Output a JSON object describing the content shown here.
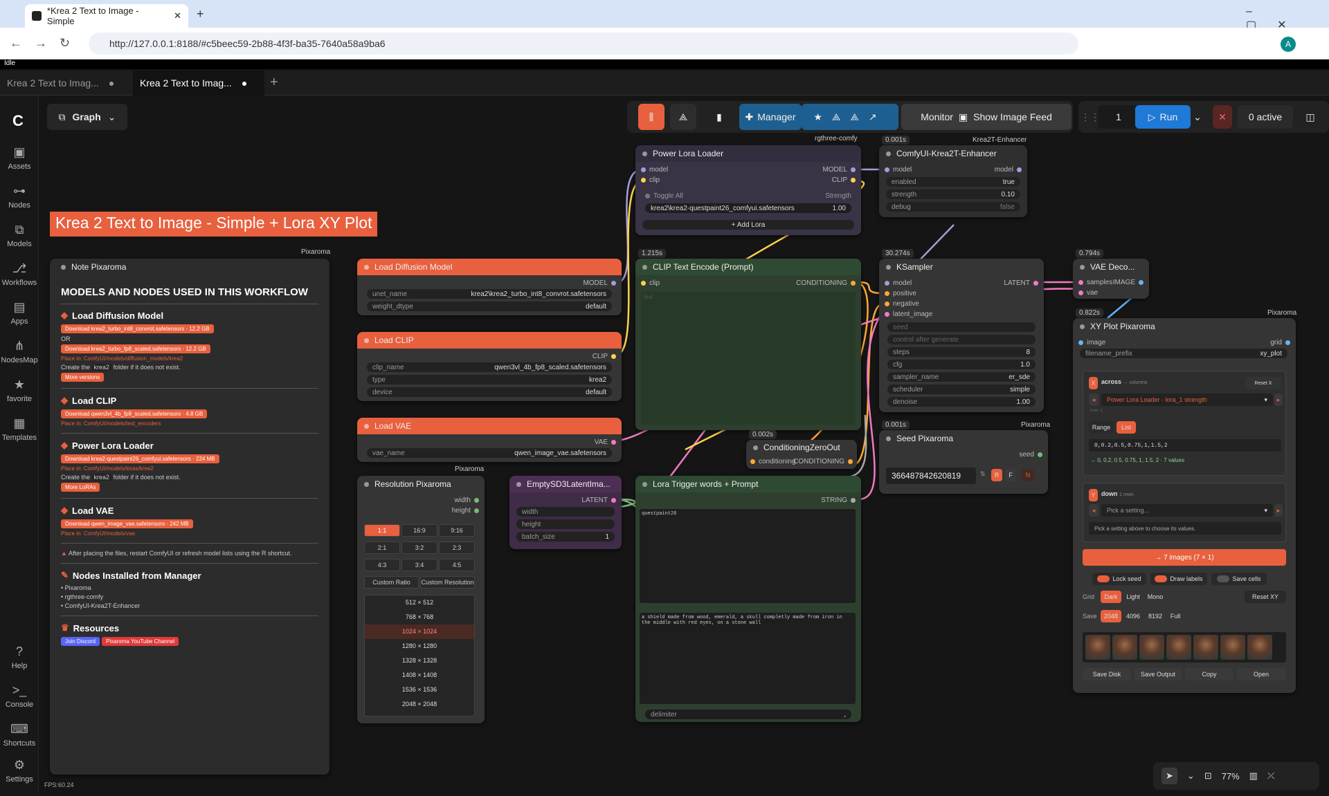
{
  "browser": {
    "tab_title": "*Krea 2 Text to Image - Simple",
    "url": "http://127.0.0.1:8188/#c5beec59-2b88-4f3f-ba35-7640a58a9ba6",
    "profile": "A"
  },
  "app": {
    "status": "Idle",
    "workflow_tabs": [
      "Krea 2 Text to Imag...",
      "Krea 2 Text to Imag..."
    ],
    "graph_label": "Graph",
    "title_banner": "Krea 2 Text to Image - Simple + Lora XY Plot",
    "fps": "FPS:60.24",
    "zoom": "77%"
  },
  "sidebar": {
    "items": [
      "Assets",
      "Nodes",
      "Models",
      "Workflows",
      "Apps",
      "NodesMap",
      "favorite",
      "Templates"
    ],
    "bottom": [
      "Help",
      "Console",
      "Shortcuts",
      "Settings"
    ]
  },
  "toolbar": {
    "manager": "Manager",
    "monitor": "Monitor",
    "show_feed": "Show Image Feed",
    "batch": "1",
    "run": "Run",
    "active": "0 active"
  },
  "note": {
    "tag": "Pixaroma",
    "title": "Note Pixaroma",
    "heading": "MODELS AND NODES USED IN THIS WORKFLOW",
    "s1": "Load Diffusion Model",
    "d1a": "Download krea2_turbo_int8_convrot.safetensors · 12.2 GB",
    "or": "OR",
    "d1b": "Download krea2_turbo_fp8_scaled.safetensors · 12.2 GB",
    "p1": "Place in: ComfyUI/models/diffusion_models/krea2",
    "c1a": "Create the",
    "c1b": "krea2",
    "c1c": "folder if it does not exist.",
    "m1": "More versions",
    "s2": "Load CLIP",
    "d2": "Download qwen3vl_4b_fp8_scaled.safetensors · 4.8 GB",
    "p2": "Place in: ComfyUI/models/text_encoders",
    "s3": "Power Lora Loader",
    "d3": "Download krea2-questpaint26_comfyui.safetensors · 224 MB",
    "p3": "Place in: ComfyUI/models/loras/krea2",
    "m3": "More LoRAs",
    "s4": "Load VAE",
    "d4": "Download qwen_image_vae.safetensors · 242 MB",
    "p4": "Place in: ComfyUI/models/vae",
    "warn": "After placing the files, restart ComfyUI or refresh model lists using the R shortcut.",
    "s5": "Nodes Installed from Manager",
    "n1": "Pixaroma",
    "n2": "rgthree-comfy",
    "n3": "ComfyUI-Krea2T-Enhancer",
    "s6": "Resources",
    "r1": "Join Discord",
    "r2": "Pixaroma YouTube Channel"
  },
  "ldm": {
    "title": "Load Diffusion Model",
    "out": "MODEL",
    "unet_name": "unet_name",
    "unet_val": "krea2\\krea2_turbo_int8_convrot.safetensors",
    "dtype": "weight_dtype",
    "dtype_val": "default"
  },
  "clip": {
    "title": "Load CLIP",
    "out": "CLIP",
    "n": "clip_name",
    "v": "qwen3vl_4b_fp8_scaled.safetensors",
    "t": "type",
    "tv": "krea2",
    "d": "device",
    "dv": "default"
  },
  "vae": {
    "title": "Load VAE",
    "out": "VAE",
    "n": "vae_name",
    "v": "qwen_image_vae.safetensors"
  },
  "res": {
    "tag": "Pixaroma",
    "title": "Resolution Pixaroma",
    "w": "width",
    "h": "height",
    "ratios": [
      "1:1",
      "16:9",
      "9:16",
      "2:1",
      "3:2",
      "2:3",
      "4:3",
      "3:4",
      "4:5"
    ],
    "c1": "Custom Ratio",
    "c2": "Custom Resolution",
    "sizes": [
      "512 × 512",
      "768 × 768",
      "1024 × 1024",
      "1280 × 1280",
      "1328 × 1328",
      "1408 × 1408",
      "1536 × 1536",
      "2048 × 2048"
    ]
  },
  "latent": {
    "title": "EmptySD3LatentIma...",
    "out": "LATENT",
    "w": "width",
    "h": "height",
    "b": "batch_size",
    "bv": "1"
  },
  "lora": {
    "tag": "rgthree-comfy",
    "title": "Power Lora Loader",
    "model": "model",
    "clip": "clip",
    "omodel": "MODEL",
    "oclip": "CLIP",
    "toggle": "Toggle All",
    "strength": "Strength",
    "lora": "krea2\\krea2-questpaint26_comfyui.safetensors",
    "sv": "1.00",
    "add": "+ Add Lora"
  },
  "enh": {
    "time": "0.001s",
    "tag": "Krea2T-Enhancer",
    "title": "ComfyUI-Krea2T-Enhancer",
    "model": "model",
    "omodel": "model",
    "en": "enabled",
    "env": "true",
    "st": "strength",
    "stv": "0.10",
    "db": "debug",
    "dbv": "false"
  },
  "cte": {
    "time": "1.215s",
    "title": "CLIP Text Encode (Prompt)",
    "clip": "clip",
    "out": "CONDITIONING",
    "text": "text"
  },
  "ks": {
    "time": "30.274s",
    "title": "KSampler",
    "out": "LATENT",
    "in": [
      "model",
      "positive",
      "negative",
      "latent_image"
    ],
    "seed": "seed",
    "cag": "control after generate",
    "steps": "steps",
    "stepsv": "8",
    "cfg": "cfg",
    "cfgv": "1.0",
    "sampler": "sampler_name",
    "samplerv": "er_sde",
    "sched": "scheduler",
    "schedv": "simple",
    "den": "denoise",
    "denv": "1.00"
  },
  "vaed": {
    "time": "0.794s",
    "title": "VAE Deco...",
    "s": "samples",
    "v": "vae",
    "out": "IMAGE"
  },
  "czo": {
    "time": "0.002s",
    "title": "ConditioningZeroOut",
    "in": "conditioning",
    "out": "CONDITIONING"
  },
  "seed": {
    "time": "0.001s",
    "tag": "Pixaroma",
    "title": "Seed Pixaroma",
    "out": "seed",
    "value": "366487842620819",
    "r": "R",
    "f": "F",
    "n": "N"
  },
  "trig": {
    "title": "Lora Trigger words + Prompt",
    "out": "STRING",
    "t1": "questpaint26",
    "t2": "a shield made from wood, emerald, a skull completly made from iron in the middle with red eyes, on a stone wall",
    "delim": "delimiter",
    "dv": ","
  },
  "xy": {
    "time": "0.822s",
    "tag": "Pixaroma",
    "title": "XY Plot Pixaroma",
    "image": "image",
    "grid": "grid",
    "fp": "filename_prefix",
    "fpv": "xy_plot",
    "across": "across",
    "cols": "→ columns",
    "reset": "Reset X",
    "sel": "Power Lora Loader · lora_1 strength",
    "now": "now: 1",
    "range": "Range",
    "list": "List",
    "vals": "0,0.2,0.5,0.75,1,1.5,2",
    "valsum": "→ 0, 0.2, 0.5, 0.75, 1, 1.5, 2 · 7 values",
    "down": "down",
    "rows": "1 rows",
    "pick": "Pick a setting...",
    "hint": "Pick a setting above to choose its values.",
    "go": "→ 7 images (7 × 1)",
    "lock": "Lock seed",
    "labels": "Draw labels",
    "cells": "Save cells",
    "g": "Grid",
    "dark": "Dark",
    "light": "Light",
    "mono": "Mono",
    "rxy": "Reset XY",
    "save": "Save",
    "s1": "2048",
    "s2": "4096",
    "s3": "8192",
    "s4": "Full",
    "b1": "Save Disk",
    "b2": "Save Output",
    "b3": "Copy",
    "b4": "Open"
  }
}
